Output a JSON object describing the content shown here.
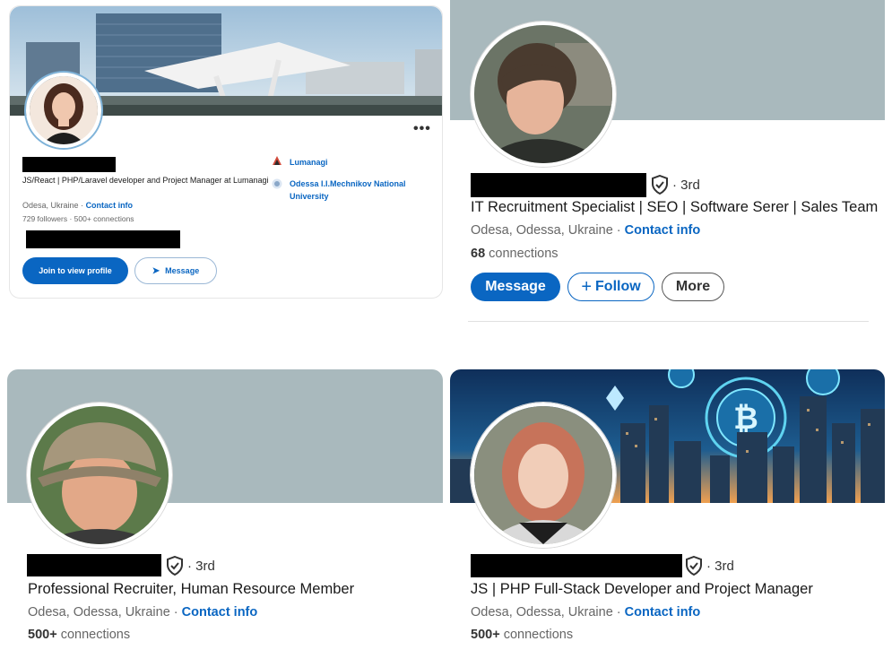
{
  "colors": {
    "link": "#0a66c2",
    "primary_button": "#0a66c2",
    "banner_gray": "#a9b9bd",
    "redaction": "#000000"
  },
  "card1": {
    "headline": "JS/React | PHP/Laravel developer and Project Manager at Lumanagi",
    "location": "Odesa, Ukraine",
    "contact_info": "Contact info",
    "followers": "729 followers",
    "connections": "500+ connections",
    "more_icon": "ellipsis-icon",
    "experience": [
      {
        "icon": "lumanagi-logo-icon",
        "name": "Lumanagi"
      },
      {
        "icon": "university-logo-icon",
        "name": "Odessa I.I.Mechnikov National University"
      }
    ],
    "join_button": "Join to view profile",
    "message_button": "Message"
  },
  "card2": {
    "degree": "· 3rd",
    "headline": "IT Recruitment Specialist | SEO | Software Serer | Sales Team",
    "location": "Odesa, Odessa, Ukraine ·",
    "contact_info": "Contact info",
    "connections_count": "68",
    "connections_label": "connections",
    "message_button": "Message",
    "follow_button": "Follow",
    "more_button": "More"
  },
  "card3": {
    "degree": "· 3rd",
    "headline": "Professional Recruiter, Human Resource Member",
    "location": "Odesa, Odessa, Ukraine ·",
    "contact_info": "Contact info",
    "connections_count": "500+",
    "connections_label": "connections"
  },
  "card4": {
    "degree": "· 3rd",
    "headline": "JS | PHP Full-Stack Developer and Project Manager",
    "location": "Odesa, Odessa, Ukraine ·",
    "contact_info": "Contact info",
    "connections_count": "500+",
    "connections_label": "connections"
  }
}
